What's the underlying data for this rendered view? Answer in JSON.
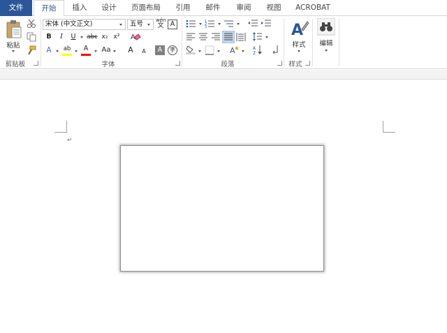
{
  "tabs": [
    "文件",
    "开始",
    "插入",
    "设计",
    "页面布局",
    "引用",
    "邮件",
    "审阅",
    "视图",
    "ACROBAT"
  ],
  "active_tab": "开始",
  "clipboard": {
    "paste_label": "粘贴",
    "group_label": "剪贴板"
  },
  "font": {
    "name_value": "宋体 (中文正文)",
    "size_value": "五号",
    "group_label": "字体",
    "bold": "B",
    "italic": "I",
    "underline": "U",
    "strike": "abc",
    "subscript": "x₂",
    "superscript": "x²",
    "grow": "A",
    "shrink": "A",
    "case": "Aa",
    "phonetic_top": "wén",
    "phonetic_bottom": "文",
    "border_char": "A",
    "shade_char": "A",
    "enclose_char": "字",
    "text_effect": "A",
    "highlight": "ab",
    "font_color": "A"
  },
  "paragraph": {
    "group_label": "段落"
  },
  "styles": {
    "label": "样式",
    "group_label": "样式"
  },
  "editing": {
    "label": "编辑"
  },
  "colors": {
    "accent": "#2b579a",
    "highlight": "#ffff00",
    "font_color": "#ff0000"
  },
  "document": {
    "paragraph_mark": "↵"
  }
}
